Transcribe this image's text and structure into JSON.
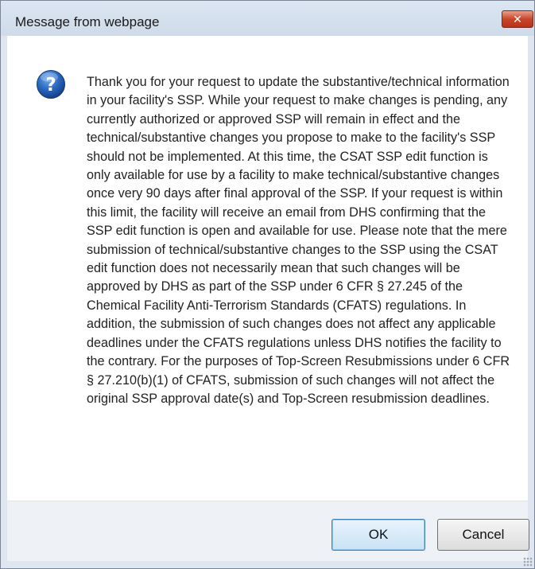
{
  "window": {
    "title": "Message from webpage",
    "close_glyph": "✕",
    "close_color": "#c9452a"
  },
  "dialog": {
    "icon": "question-icon",
    "icon_color": "#1f5fb5",
    "message": "Thank you for your request to update the substantive/technical information in your facility's SSP. While your request to make changes is pending, any currently authorized or approved SSP will remain in effect and the technical/substantive changes you propose to make to the facility's SSP should not be implemented. At this time, the CSAT SSP edit function is only available for use by a facility to make technical/substantive changes once very 90 days after final approval of the SSP. If your request is within this limit, the facility will receive an email from DHS confirming that the SSP edit function is open and available for use.  Please note that the mere submission of technical/substantive changes to the SSP using the CSAT edit function does not necessarily mean that such changes will be approved by DHS as part of the SSP under 6 CFR § 27.245 of the Chemical Facility Anti-Terrorism Standards (CFATS) regulations. In addition,  the submission of such changes does not affect any applicable deadlines under the CFATS regulations unless DHS notifies the facility to the contrary. For the purposes of Top-Screen Resubmissions under 6 CFR § 27.210(b)(1) of CFATS, submission of such changes will not affect the original SSP approval date(s) and Top-Screen resubmission deadlines."
  },
  "buttons": {
    "ok_label": "OK",
    "cancel_label": "Cancel"
  }
}
